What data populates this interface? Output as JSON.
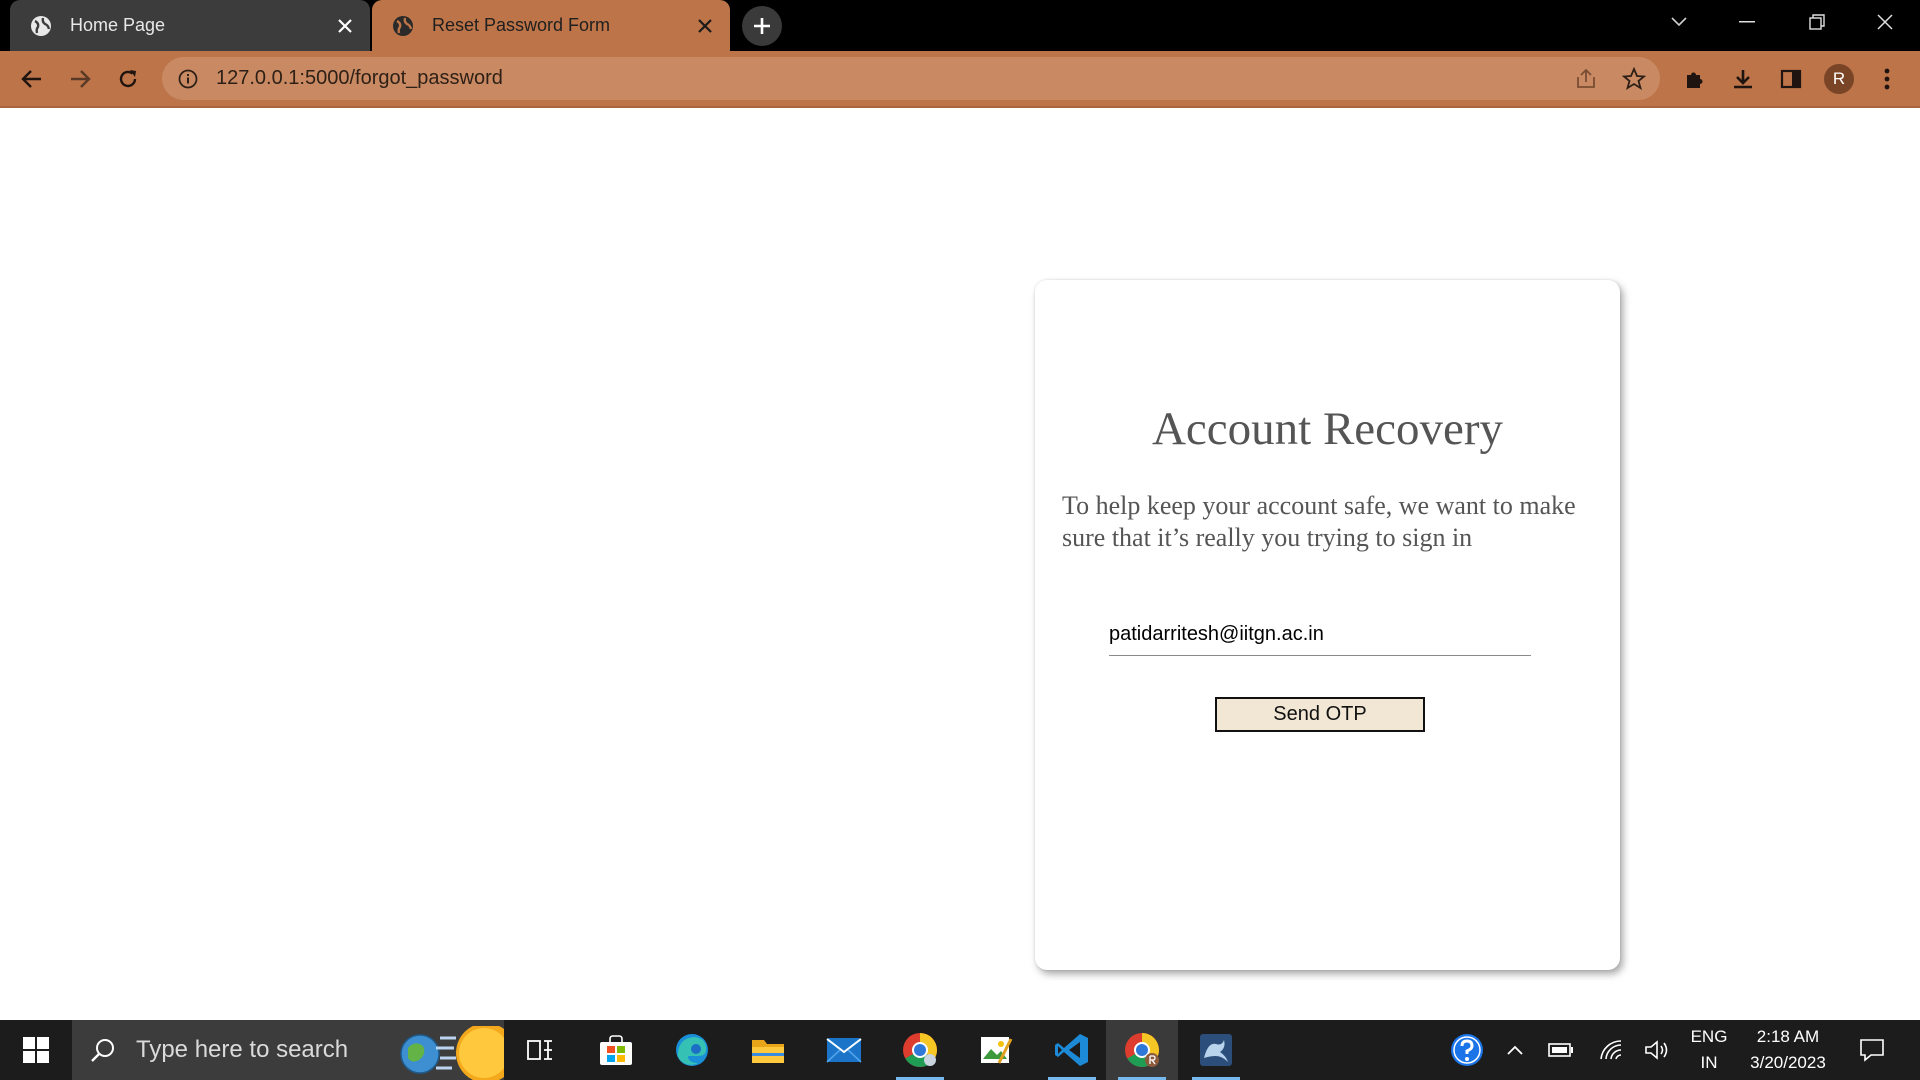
{
  "browser": {
    "tabs": [
      {
        "title": "Home Page",
        "active": false
      },
      {
        "title": "Reset Password Form",
        "active": true
      }
    ],
    "url": "127.0.0.1:5000/forgot_password",
    "profile_initial": "R",
    "theme_color": "#bc7448"
  },
  "page": {
    "title": "Account Recovery",
    "description": "To help keep your account safe, we want to make sure that it’s really you trying to sign in",
    "email_value": "patidarritesh@iitgn.ac.in",
    "submit_label": "Send OTP"
  },
  "taskbar": {
    "search_placeholder": "Type here to search",
    "language_line1": "ENG",
    "language_line2": "IN",
    "time": "2:18 AM",
    "date": "3/20/2023",
    "apps": [
      "task-view-icon",
      "microsoft-store-icon",
      "edge-icon",
      "file-explorer-icon",
      "mail-icon",
      "chrome-icon",
      "image-editor-icon",
      "vscode-icon",
      "chrome-profile-icon",
      "mysql-workbench-icon"
    ]
  }
}
